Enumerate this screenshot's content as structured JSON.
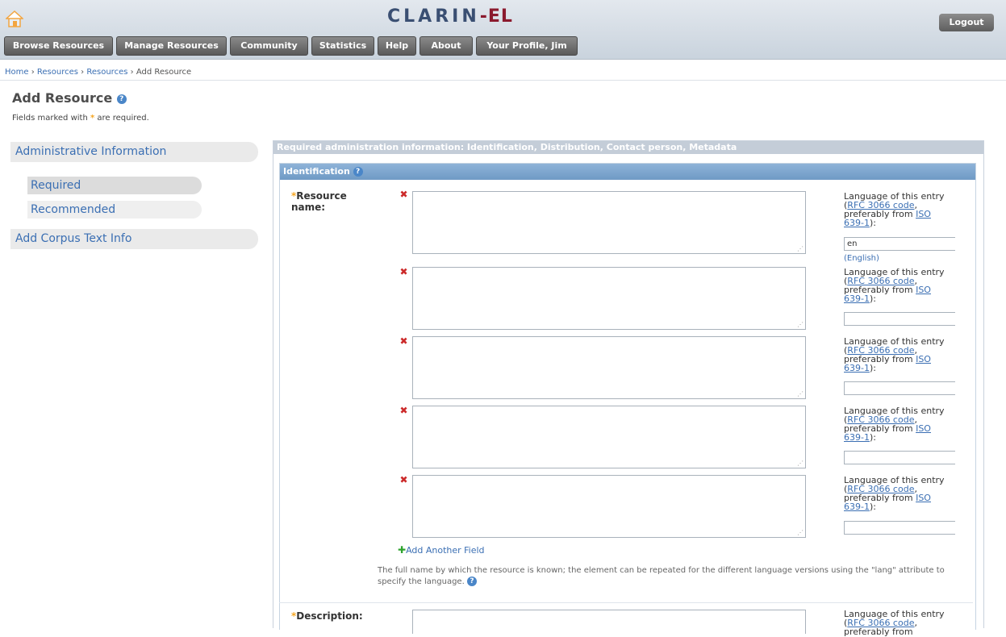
{
  "header": {
    "logo_main": "CLARIN",
    "logo_dash": "-",
    "logo_el": "EL",
    "logout_label": "Logout",
    "icons": {
      "home": "home-icon"
    }
  },
  "nav": [
    "Browse Resources",
    "Manage Resources",
    "Community",
    "Statistics",
    "Help",
    "About",
    "Your Profile, Jim"
  ],
  "breadcrumb": {
    "items": [
      "Home",
      "Resources",
      "Resources"
    ],
    "separator": "›",
    "current": "Add Resource"
  },
  "page": {
    "title": "Add Resource",
    "required_note_prefix": "Fields marked with",
    "required_note_suffix": "are required."
  },
  "sidebar": {
    "section1": "Administrative Information",
    "sub_required": "Required",
    "sub_recommended": "Recommended",
    "section2": "Add Corpus Text Info"
  },
  "panel": {
    "header": "Required administration information: Identification, Distribution, Contact person, Metadata"
  },
  "identification": {
    "title": "Identification",
    "resource_name_label": "Resource name:",
    "lang_text_1": "Language of this entry (",
    "lang_link_rfc": "RFC 3066 code",
    "lang_text_2": ", preferably from",
    "lang_link_iso": "ISO 639-1",
    "lang_text_3": "):",
    "first_lang_value": "en",
    "first_lang_name": "(English)",
    "add_another": "Add Another Field",
    "description_help": "The full name by which the resource is known; the element can be repeated for the different language versions using the \"lang\" attribute to specify the language.",
    "description_label": "Description:"
  },
  "colors": {
    "accent_blue": "#3b6fb3",
    "logo_dark": "#3a4f72",
    "logo_red": "#8b1a2e",
    "required_star": "#f5a623",
    "remove_red": "#cc2a2a",
    "add_green": "#2ea32e"
  }
}
